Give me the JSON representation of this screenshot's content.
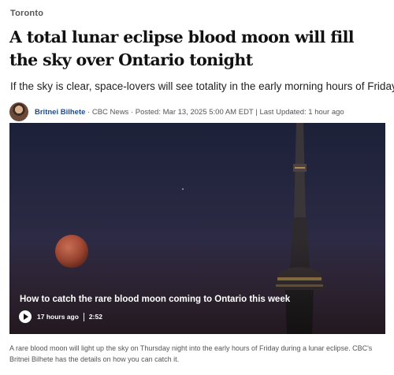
{
  "article": {
    "section": "Toronto",
    "headline": "A total lunar eclipse blood moon will fill the sky over Ontario tonight",
    "deck": "If the sky is clear, space-lovers will see totality in the early morning hours of Friday",
    "byline": {
      "author": "Britnei Bilhete",
      "separator": " · ",
      "source": "CBC News",
      "posted": "Posted: Mar 13, 2025 5:00 AM EDT",
      "updated_separator": " | ",
      "updated": "Last Updated: 1 hour ago"
    },
    "media": {
      "caption": "How to catch the rare blood moon coming to Ontario this week",
      "time_ago": "17 hours ago",
      "duration": "2:52",
      "description": "A rare blood moon will light up the sky on Thursday night into the early hours of Friday during a lunar eclipse. CBC's Britnei Bilhete has the details on how you can catch it."
    }
  },
  "colors": {
    "author_link": "#1f4d8c",
    "moon": "#b5533c",
    "sky_top": "#1c2138",
    "sky_bottom": "#4c3545"
  },
  "icons": {
    "play": "play-icon",
    "avatar": "avatar"
  }
}
